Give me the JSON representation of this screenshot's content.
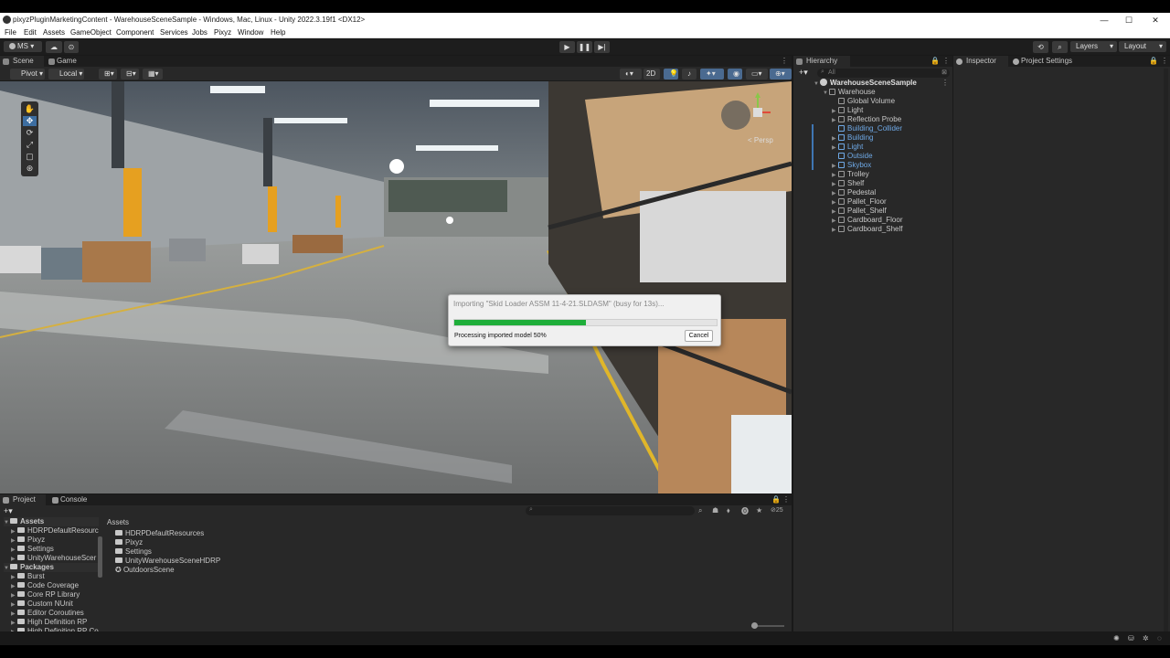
{
  "window": {
    "title": "pixyzPluginMarketingContent - WarehouseSceneSample - Windows, Mac, Linux - Unity 2022.3.19f1 <DX12>",
    "minimize": "—",
    "maximize": "☐",
    "close": "✕"
  },
  "menu": [
    "File",
    "Edit",
    "Assets",
    "GameObject",
    "Component",
    "Services",
    "Jobs",
    "Pixyz",
    "Window",
    "Help"
  ],
  "toolbar": {
    "account": "MS",
    "layers_label": "Layers",
    "layout_label": "Layout"
  },
  "scene": {
    "tabs": [
      "Scene",
      "Game"
    ],
    "pivot_label": "Pivot",
    "local_label": "Local",
    "mode_2d": "2D",
    "persp_label": "< Persp"
  },
  "hierarchy": {
    "tab_label": "Hierarchy",
    "search_placeholder": "All",
    "scene_name": "WarehouseSceneSample",
    "items": [
      {
        "label": "Warehouse",
        "indent": 1,
        "expanded": true,
        "blue": false
      },
      {
        "label": "Global Volume",
        "indent": 2,
        "expanded": null,
        "blue": false
      },
      {
        "label": "Light",
        "indent": 2,
        "expanded": false,
        "blue": false
      },
      {
        "label": "Reflection Probe",
        "indent": 2,
        "expanded": false,
        "blue": false
      },
      {
        "label": "Building_Collider",
        "indent": 2,
        "expanded": null,
        "blue": true
      },
      {
        "label": "Building",
        "indent": 2,
        "expanded": false,
        "blue": true
      },
      {
        "label": "Light",
        "indent": 2,
        "expanded": false,
        "blue": true
      },
      {
        "label": "Outside",
        "indent": 2,
        "expanded": null,
        "blue": true
      },
      {
        "label": "Skybox",
        "indent": 2,
        "expanded": false,
        "blue": true
      },
      {
        "label": "Trolley",
        "indent": 2,
        "expanded": false,
        "blue": false
      },
      {
        "label": "Shelf",
        "indent": 2,
        "expanded": false,
        "blue": false
      },
      {
        "label": "Pedestal",
        "indent": 2,
        "expanded": false,
        "blue": false
      },
      {
        "label": "Pallet_Floor",
        "indent": 2,
        "expanded": false,
        "blue": false
      },
      {
        "label": "Pallet_Shelf",
        "indent": 2,
        "expanded": false,
        "blue": false
      },
      {
        "label": "Cardboard_Floor",
        "indent": 2,
        "expanded": false,
        "blue": false
      },
      {
        "label": "Cardboard_Shelf",
        "indent": 2,
        "expanded": false,
        "blue": false
      }
    ]
  },
  "inspector": {
    "tabs": [
      "Inspector",
      "Project Settings"
    ]
  },
  "project": {
    "tabs": [
      "Project",
      "Console"
    ],
    "count_badge": "25",
    "tree": [
      {
        "label": "Assets",
        "bold": true,
        "indent": 0
      },
      {
        "label": "HDRPDefaultResourc",
        "bold": false,
        "indent": 1
      },
      {
        "label": "Pixyz",
        "bold": false,
        "indent": 1
      },
      {
        "label": "Settings",
        "bold": false,
        "indent": 1
      },
      {
        "label": "UnityWarehouseScer",
        "bold": false,
        "indent": 1
      },
      {
        "label": "Packages",
        "bold": true,
        "indent": 0
      },
      {
        "label": "Burst",
        "bold": false,
        "indent": 1
      },
      {
        "label": "Code Coverage",
        "bold": false,
        "indent": 1
      },
      {
        "label": "Core RP Library",
        "bold": false,
        "indent": 1
      },
      {
        "label": "Custom NUnit",
        "bold": false,
        "indent": 1
      },
      {
        "label": "Editor Coroutines",
        "bold": false,
        "indent": 1
      },
      {
        "label": "High Definition RP",
        "bold": false,
        "indent": 1
      },
      {
        "label": "High Definition RP Co",
        "bold": false,
        "indent": 1
      }
    ],
    "breadcrumb": "Assets",
    "assets": [
      {
        "label": "HDRPDefaultResources",
        "kind": "folder"
      },
      {
        "label": "Pixyz",
        "kind": "folder"
      },
      {
        "label": "Settings",
        "kind": "folder"
      },
      {
        "label": "UnityWarehouseSceneHDRP",
        "kind": "folder"
      },
      {
        "label": "OutdoorsScene",
        "kind": "scene"
      }
    ]
  },
  "import_dialog": {
    "title": "Importing \"Skid Loader ASSM 11-4-21.SLDASM\" (busy for 13s)...",
    "progress": 0.5,
    "status": "Processing imported model 50%",
    "cancel_label": "Cancel"
  },
  "colors": {
    "accent_blue": "#6fa9e6",
    "progress_green": "#1fae3a",
    "panel_bg": "#282828",
    "safety_yellow": "#e8b020"
  }
}
